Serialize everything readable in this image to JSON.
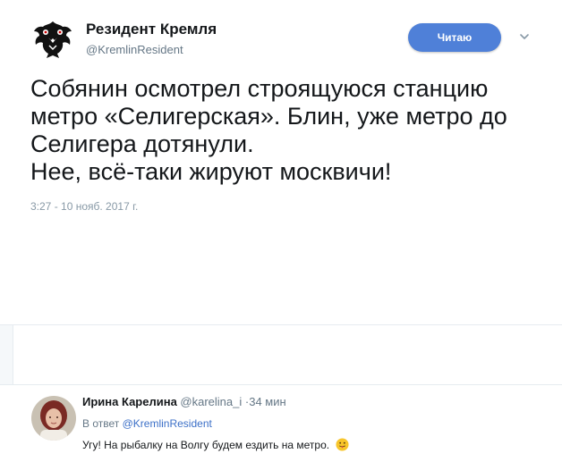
{
  "tweet": {
    "author_name": "Резидент Кремля",
    "author_handle": "@KremlinResident",
    "follow_button": "Читаю",
    "text_lines": [
      "Собянин осмотрел строящуюся станцию",
      "метро «Селигерская». Блин, уже метро до",
      "Селигера дотянули.",
      "Нее, всё-таки жируют москвичи!"
    ],
    "timestamp": "3:27 - 10 нояб. 2017 г."
  },
  "reply": {
    "author_name": "Ирина Карелина",
    "author_handle": "@karelina_i",
    "time": "·34 мин",
    "in_reply_prefix": "В ответ",
    "in_reply_handle": "@KremlinResident",
    "text": "Угу! На рыбалку на Волгу будем ездить на метро.",
    "emoji": "tongue-face-emoji"
  },
  "colors": {
    "accent": "#4f80d8",
    "link": "#3b6fc7",
    "muted": "#657786"
  }
}
